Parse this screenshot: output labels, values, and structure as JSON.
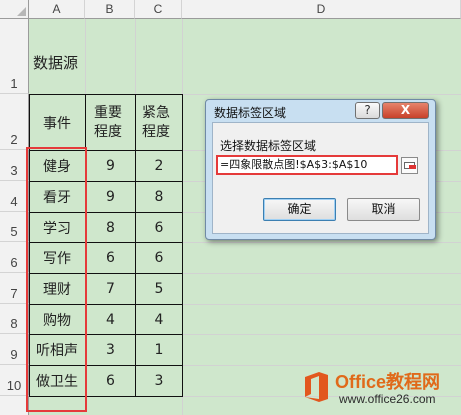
{
  "spreadsheet": {
    "columns": [
      "A",
      "B",
      "C",
      "D"
    ],
    "rows": [
      "1",
      "2",
      "3",
      "4",
      "5",
      "6",
      "7",
      "8",
      "9",
      "10"
    ],
    "title_cell": "数据源",
    "headers": {
      "event": "事件",
      "importance": "重要程度",
      "urgency": "紧急程度"
    },
    "data": [
      {
        "event": "健身",
        "importance": "9",
        "urgency": "2"
      },
      {
        "event": "看牙",
        "importance": "9",
        "urgency": "8"
      },
      {
        "event": "学习",
        "importance": "8",
        "urgency": "6"
      },
      {
        "event": "写作",
        "importance": "6",
        "urgency": "6"
      },
      {
        "event": "理财",
        "importance": "7",
        "urgency": "5"
      },
      {
        "event": "购物",
        "importance": "4",
        "urgency": "4"
      },
      {
        "event": "听相声",
        "importance": "3",
        "urgency": "1"
      },
      {
        "event": "做卫生",
        "importance": "6",
        "urgency": "3"
      }
    ]
  },
  "dialog": {
    "title": "数据标签区域",
    "help_label": "?",
    "close_label": "X",
    "field_label": "选择数据标签区域",
    "field_value": "=四象限散点图!$A$3:$A$10",
    "ok_label": "确定",
    "cancel_label": "取消"
  },
  "watermark": {
    "line1": "Office教程网",
    "line2": "www.office26.com"
  },
  "colors": {
    "sheet_bg": "#cfe7cc",
    "highlight": "#e53a3a",
    "dialog_frame": "#c8dff1"
  }
}
